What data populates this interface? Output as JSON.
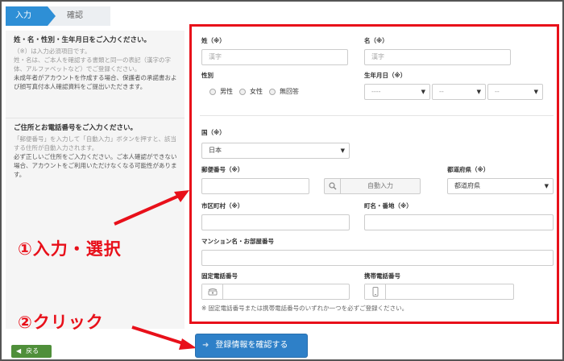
{
  "steps": {
    "current": "入力",
    "next": "確認"
  },
  "left": {
    "s1_title": "姓・名・性別・生年月日をご入力ください。",
    "s1_l1": "（※）は入力必須項目です。",
    "s1_l2": "姓・名は、ご本人を確認する書類と同一の表記（漢字の字",
    "s1_l3": "体、アルファベットなど）でご登録ください。",
    "s1_l4": "未成年者がアカウントを作成する場合、保護者の承諾書およ",
    "s1_l5": "び顔写真付本人確認資料をご提出いただきます。",
    "s2_title": "ご住所とお電話番号をご入力ください。",
    "s2_l1": "「郵便番号」を入力して「自動入力」ボタンを押すと、該当",
    "s2_l2": "する住所が自動入力されます。",
    "s2_l3": "必ず正しいご住所をご入力ください。ご本人確認ができない",
    "s2_l4": "場合、アカウントをご利用いただけなくなる可能性がありま",
    "s2_l5": "す。"
  },
  "form": {
    "sei_label": "姓（※）",
    "sei_placeholder": "漢字",
    "mei_label": "名（※）",
    "mei_placeholder": "漢字",
    "gender_label": "性別",
    "gender_options": [
      "男性",
      "女性",
      "無回答"
    ],
    "birth_label": "生年月日（※）",
    "birth_year": "----",
    "birth_month": "--",
    "birth_day": "--",
    "country_label": "国（※）",
    "country_value": "日本",
    "zip_label": "郵便番号（※）",
    "auto_fill": "自動入力",
    "pref_label": "都道府県（※）",
    "pref_value": "都道府県",
    "city_label": "市区町村（※）",
    "street_label": "町名・番地（※）",
    "building_label": "マンション名・お部屋番号",
    "landline_label": "固定電話番号",
    "mobile_label": "携帯電話番号",
    "phone_note": "※ 固定電話番号または携帯電話番号のいずれか一つを必ずご登録ください。"
  },
  "annotations": {
    "step1": "①入力・選択",
    "step2": "②クリック"
  },
  "buttons": {
    "back": "戻る",
    "confirm": "登録情報を確認する"
  },
  "colors": {
    "accent": "#2e8fd6",
    "highlight_red": "#e8101a",
    "back_green": "#4f8f3a",
    "confirm_blue": "#2e80c8"
  }
}
